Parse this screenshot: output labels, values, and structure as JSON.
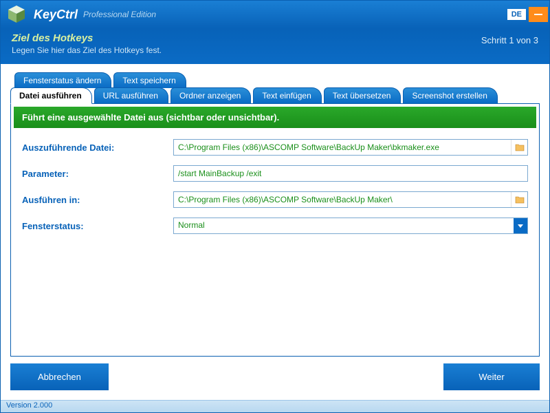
{
  "titlebar": {
    "app_name": "KeyCtrl",
    "edition": "Professional Edition",
    "lang": "DE"
  },
  "subheader": {
    "title": "Ziel des Hotkeys",
    "desc": "Legen Sie hier das Ziel des Hotkeys fest.",
    "step": "Schritt 1 von 3"
  },
  "tabs_top": [
    {
      "label": "Fensterstatus ändern"
    },
    {
      "label": "Text speichern"
    }
  ],
  "tabs_bottom": [
    {
      "label": "Datei ausführen",
      "active": true
    },
    {
      "label": "URL ausführen"
    },
    {
      "label": "Ordner anzeigen"
    },
    {
      "label": "Text einfügen"
    },
    {
      "label": "Text übersetzen"
    },
    {
      "label": "Screenshot erstellen"
    }
  ],
  "panel": {
    "banner": "Führt eine ausgewählte Datei aus (sichtbar oder unsichtbar).",
    "fields": {
      "file_label": "Auszuführende Datei:",
      "file_value": "C:\\Program Files (x86)\\ASCOMP Software\\BackUp Maker\\bkmaker.exe",
      "param_label": "Parameter:",
      "param_value": "/start MainBackup /exit",
      "runin_label": "Ausführen in:",
      "runin_value": "C:\\Program Files (x86)\\ASCOMP Software\\BackUp Maker\\",
      "winstate_label": "Fensterstatus:",
      "winstate_value": "Normal"
    }
  },
  "footer": {
    "cancel": "Abbrechen",
    "next": "Weiter"
  },
  "version": "Version 2.000"
}
